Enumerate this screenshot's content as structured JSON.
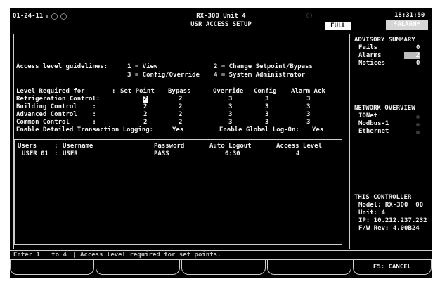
{
  "header": {
    "date": "01-24-11",
    "unit_title": "RX-300 Unit 4",
    "screen_title": "USR ACCESS SETUP",
    "mode_badge": "FULL",
    "time": "18:31:50",
    "alarm_badge": "*ALARM*"
  },
  "guidelines": {
    "label": "Access level guidelines:",
    "level1": "1 = View",
    "level2": "2 = Change Setpoint/Bypass",
    "level3": "3 = Config/Override",
    "level4": "4 = System Administrator"
  },
  "level_table": {
    "header_label": "Level Required for",
    "header_sep": ":",
    "columns": [
      "Set Point",
      "Bypass",
      "Override",
      "Config",
      "Alarm Ack"
    ],
    "rows": [
      {
        "label": "Refrigeration Control:",
        "values": [
          "2",
          "2",
          "3",
          "3",
          "3"
        ]
      },
      {
        "label": "Building Control    :",
        "values": [
          "2",
          "2",
          "3",
          "3",
          "3"
        ]
      },
      {
        "label": "Advanced Control    :",
        "values": [
          "2",
          "2",
          "3",
          "3",
          "3"
        ]
      },
      {
        "label": "Common Control      :",
        "values": [
          "2",
          "2",
          "3",
          "3",
          "3"
        ]
      }
    ]
  },
  "logging": {
    "detailed_label": "Enable Detailed Transaction Logging:",
    "detailed_value": "Yes",
    "global_label": "Enable Global Log-On:",
    "global_value": "Yes"
  },
  "users_table": {
    "headers": {
      "users": "Users",
      "sep": ":",
      "username": "Username",
      "password": "Password",
      "auto_logout": "Auto Logout",
      "access_level": "Access Level"
    },
    "rows": [
      {
        "user": "USER 01",
        "sep": ":",
        "username": "USER",
        "password": "PASS",
        "auto_logout": "0:30",
        "access_level": "4"
      }
    ]
  },
  "advisory": {
    "title": "ADVISORY SUMMARY",
    "fails_label": "Fails",
    "fails_value": "0",
    "alarms_label": "Alarms",
    "alarms_value": "2",
    "notices_label": "Notices",
    "notices_value": "0"
  },
  "network": {
    "title": "NETWORK OVERVIEW",
    "items": [
      "IONet",
      "Modbus-1",
      "Ethernet"
    ]
  },
  "controller": {
    "title": "THIS CONTROLLER",
    "model": "Model: RX-300  00",
    "unit": "Unit: 4",
    "ip": "IP: 10.212.237.232",
    "fw": "F/W Rev: 4.00B24"
  },
  "status_bar": {
    "range": "Enter 1   to 4",
    "message": "Access level required for set points."
  },
  "function_keys": {
    "f5": "F5: CANCEL"
  }
}
